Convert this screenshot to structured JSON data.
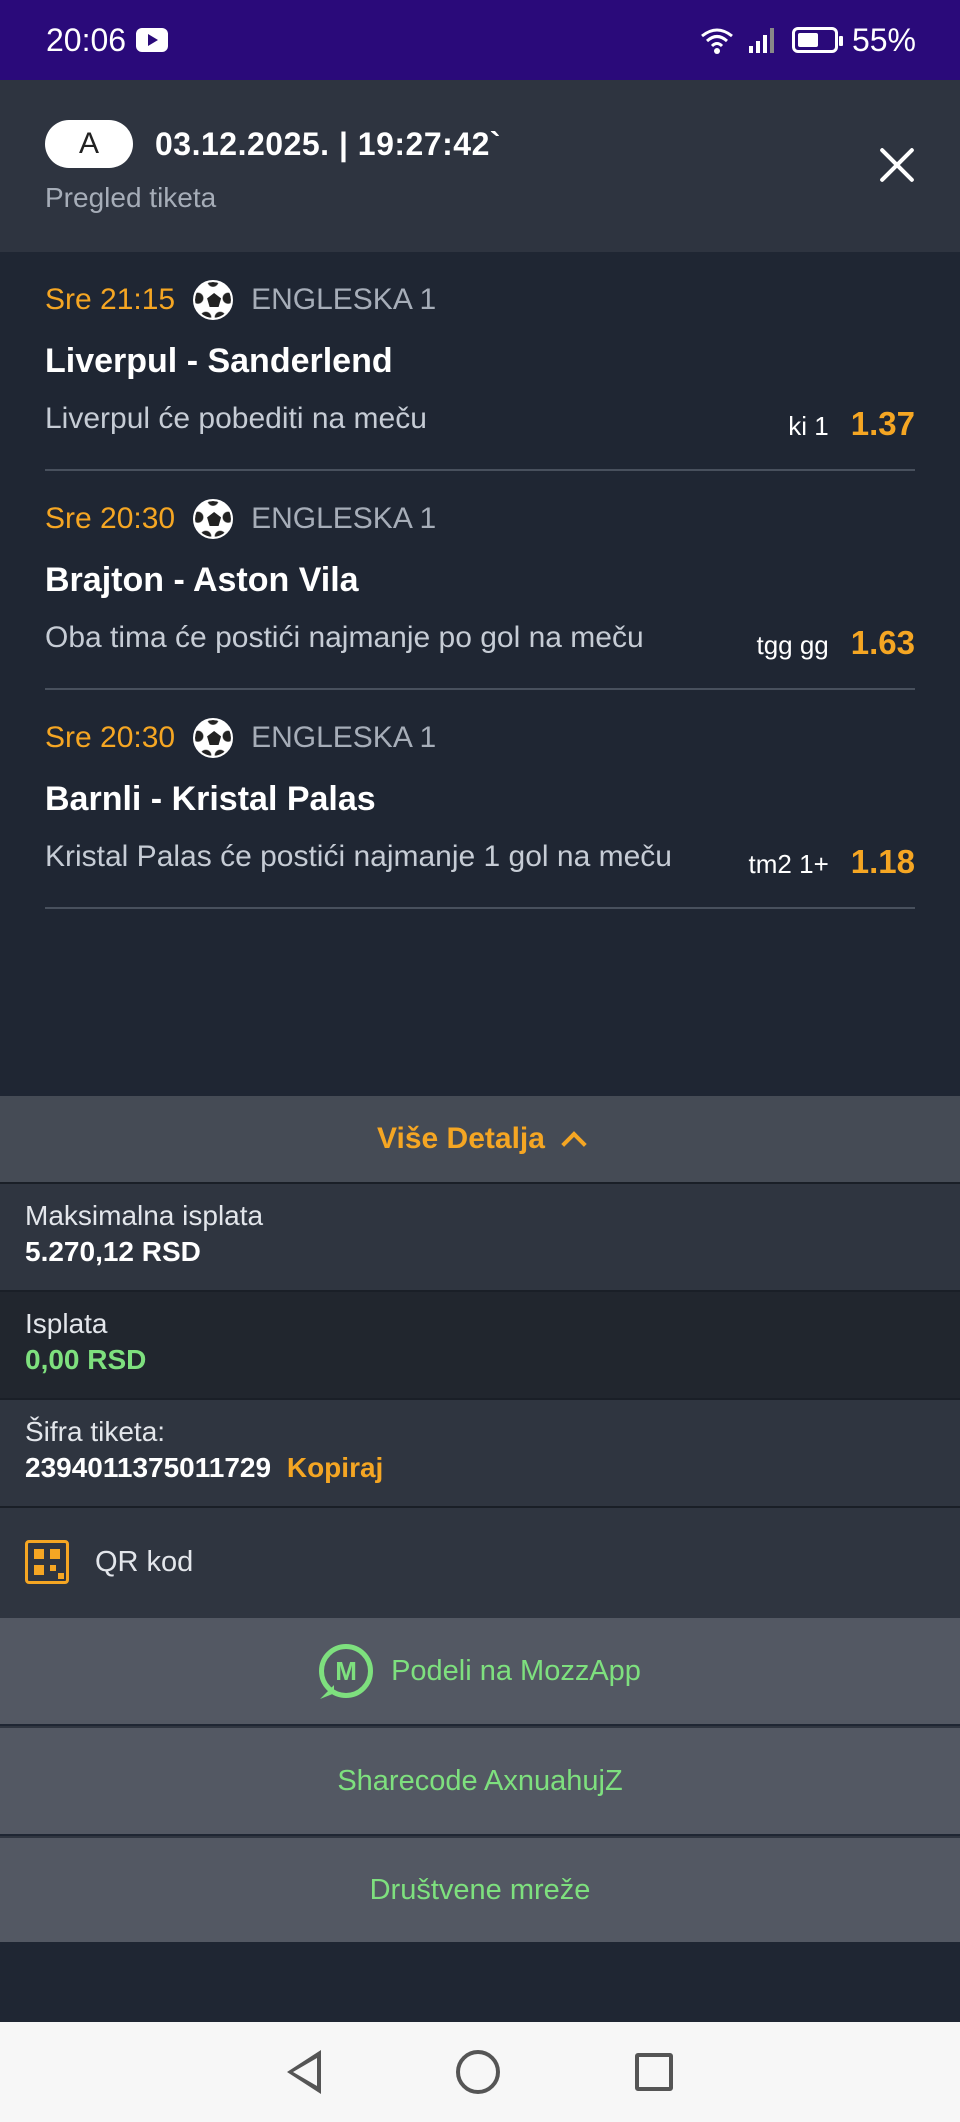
{
  "status": {
    "time": "20:06",
    "battery": "55%"
  },
  "header": {
    "badge": "A",
    "datetime": "03.12.2025. | 19:27:42`",
    "subtitle": "Pregled tiketa"
  },
  "events": [
    {
      "time": "Sre 21:15",
      "league": "ENGLESKA 1",
      "title": "Liverpul - Sanderlend",
      "bet": "Liverpul će pobediti na meču",
      "code": "ki 1",
      "odd": "1.37"
    },
    {
      "time": "Sre 20:30",
      "league": "ENGLESKA 1",
      "title": "Brajton - Aston Vila",
      "bet": "Oba tima će postići najmanje po gol na meču",
      "code": "tgg gg",
      "odd": "1.63"
    },
    {
      "time": "Sre 20:30",
      "league": "ENGLESKA 1",
      "title": "Barnli - Kristal Palas",
      "bet": "Kristal Palas će postići najmanje 1 gol na meču",
      "code": "tm2 1+",
      "odd": "1.18"
    }
  ],
  "details_button": "Više Detalja",
  "info": {
    "max_payout_label": "Maksimalna isplata",
    "max_payout_value": "5.270,12 RSD",
    "payout_label": "Isplata",
    "payout_value": "0,00 RSD",
    "ticket_code_label": "Šifra tiketa:",
    "ticket_code_value": "2394011375011729",
    "copy_label": "Kopiraj",
    "qr_label": "QR kod"
  },
  "actions": {
    "share_mozzapp": "Podeli na MozzApp",
    "mozz_icon_text": "M",
    "sharecode": "Sharecode AxnuahujZ",
    "social": "Društvene mreže"
  },
  "colors": {
    "accent": "#f5a623",
    "green": "#7ee07e",
    "statusbar": "#2a0a7a",
    "background": "#1f2633"
  }
}
